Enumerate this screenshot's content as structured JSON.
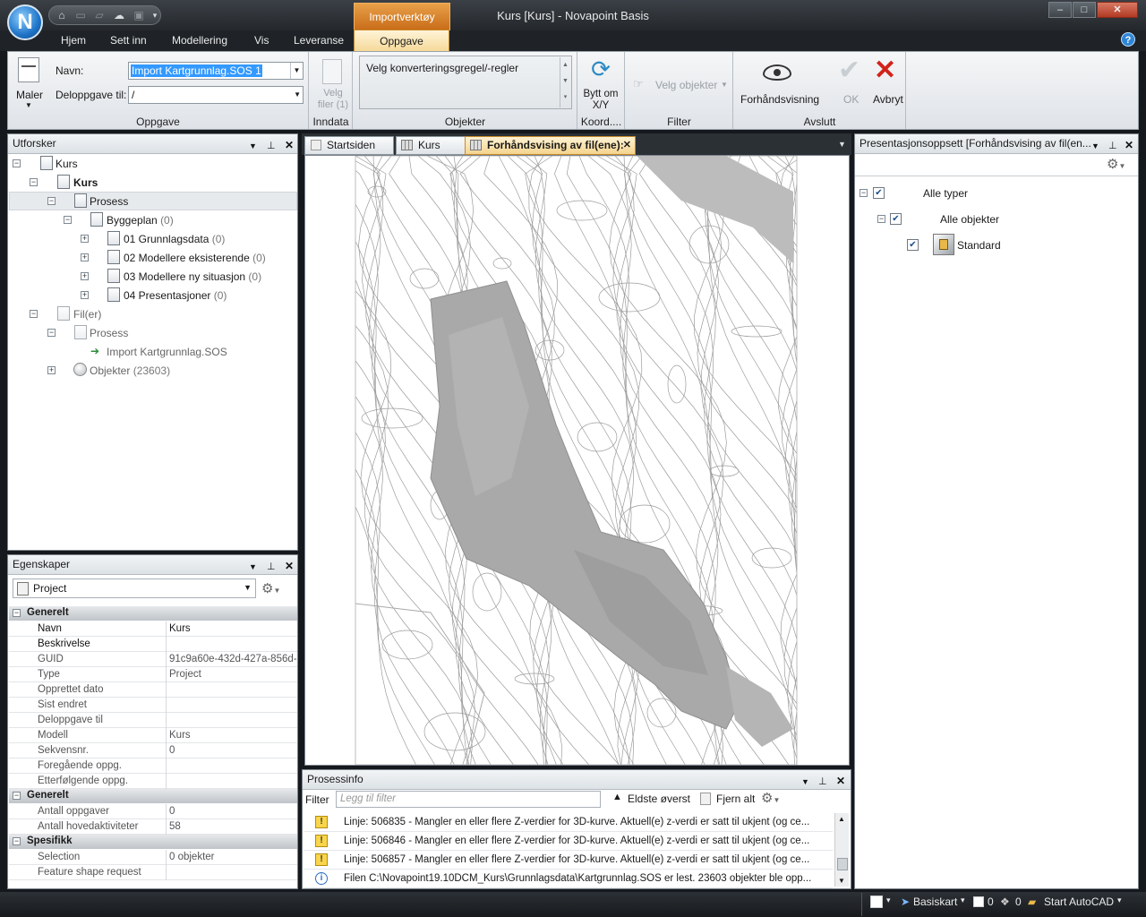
{
  "app": {
    "logo": "N",
    "title": "Kurs [Kurs] - Novapoint Basis",
    "context_tab": "Importverktøy",
    "window_buttons": {
      "minimize": "–",
      "maximize": "□",
      "close": "✕"
    }
  },
  "menu": {
    "tabs": [
      "Hjem",
      "Sett inn",
      "Modellering",
      "Vis",
      "Leveranse"
    ],
    "active_tab": "Oppgave",
    "help": "?"
  },
  "ribbon": {
    "maler": "Maler",
    "navn_label": "Navn:",
    "navn_value": "Import Kartgrunnlag.SOS 1",
    "deloppgave_label": "Deloppgave til:",
    "deloppgave_value": "/",
    "group_oppgave": "Oppgave",
    "velg_filer": "Velg filer (1)",
    "group_inndata": "Inndata",
    "konvertering": "Velg konverteringsgregel/-regler",
    "group_objekter": "Objekter",
    "bytt_om": "Bytt om X/Y",
    "group_koord": "Koord....",
    "velg_objekter": "Velg objekter",
    "group_filter": "Filter",
    "forhandsvisning": "Forhåndsvisning",
    "ok": "OK",
    "avbryt": "Avbryt",
    "group_avslutt": "Avslutt"
  },
  "explorer": {
    "title": "Utforsker",
    "rows": [
      {
        "label": "Kurs",
        "count": ""
      },
      {
        "label": "Kurs",
        "count": ""
      },
      {
        "label": "Prosess",
        "count": ""
      },
      {
        "label": "Byggeplan",
        "count": "(0)"
      },
      {
        "label": "01 Grunnlagsdata",
        "count": "(0)"
      },
      {
        "label": "02 Modellere eksisterende",
        "count": "(0)"
      },
      {
        "label": "03 Modellere ny situasjon",
        "count": "(0)"
      },
      {
        "label": "04 Presentasjoner",
        "count": "(0)"
      },
      {
        "label": "Fil(er)",
        "count": ""
      },
      {
        "label": "Prosess",
        "count": ""
      },
      {
        "label": "Import Kartgrunnlag.SOS",
        "count": ""
      },
      {
        "label": "Objekter",
        "count": "(23603)"
      }
    ]
  },
  "properties": {
    "title": "Egenskaper",
    "selector": "Project",
    "categories": [
      {
        "name": "Generelt",
        "rows": [
          [
            "Navn",
            "Kurs"
          ],
          [
            "Beskrivelse",
            ""
          ],
          [
            "GUID",
            "91c9a60e-432d-427a-856d-..."
          ],
          [
            "Type",
            "Project"
          ],
          [
            "Opprettet dato",
            ""
          ],
          [
            "Sist endret",
            ""
          ],
          [
            "Deloppgave til",
            ""
          ],
          [
            "Modell",
            "Kurs"
          ],
          [
            "Sekvensnr.",
            "0"
          ],
          [
            "Foregående oppg.",
            ""
          ],
          [
            "Etterfølgende oppg.",
            ""
          ]
        ]
      },
      {
        "name": "Generelt",
        "rows": [
          [
            "Antall oppgaver",
            "0"
          ],
          [
            "Antall hovedaktiviteter",
            "58"
          ]
        ]
      },
      {
        "name": "Spesifikk",
        "rows": [
          [
            "Selection",
            "0 objekter"
          ],
          [
            "Feature shape request",
            ""
          ]
        ]
      }
    ]
  },
  "doc_tabs": [
    "Startsiden",
    "Kurs",
    "Forhåndsvising av fil(ene):"
  ],
  "presentation": {
    "title": "Presentasjonsoppsett [Forhåndsvising av fil(en...",
    "rows": [
      "Alle typer",
      "Alle objekter",
      "Standard"
    ]
  },
  "process": {
    "title": "Prosessinfo",
    "filter_label": "Filter",
    "filter_placeholder": "Legg til filter",
    "oldest_first": "Eldste øverst",
    "remove_all": "Fjern alt",
    "rows": [
      {
        "type": "warning",
        "text": "Linje: 506835 - Mangler en eller flere Z-verdier for 3D-kurve. Aktuell(e) z-verdi er satt til ukjent  (og ce..."
      },
      {
        "type": "warning",
        "text": "Linje: 506846 - Mangler en eller flere Z-verdier for 3D-kurve. Aktuell(e) z-verdi er satt til ukjent  (og ce..."
      },
      {
        "type": "warning",
        "text": "Linje: 506857 - Mangler en eller flere Z-verdier for 3D-kurve. Aktuell(e) z-verdi er satt til ukjent  (og ce..."
      },
      {
        "type": "info",
        "text": "Filen C:\\Novapoint19.10DCM_Kurs\\Grunnlagsdata\\Kartgrunnlag.SOS er lest.  23603 objekter ble opp..."
      }
    ]
  },
  "status": {
    "basiskart": "Basiskart",
    "count1": "0",
    "count2": "0",
    "autocad": "Start AutoCAD"
  },
  "colors": {
    "ribbon_accent": "#f5d896",
    "context_orange": "#e8a048",
    "map_fill": "#a9a9a9"
  }
}
